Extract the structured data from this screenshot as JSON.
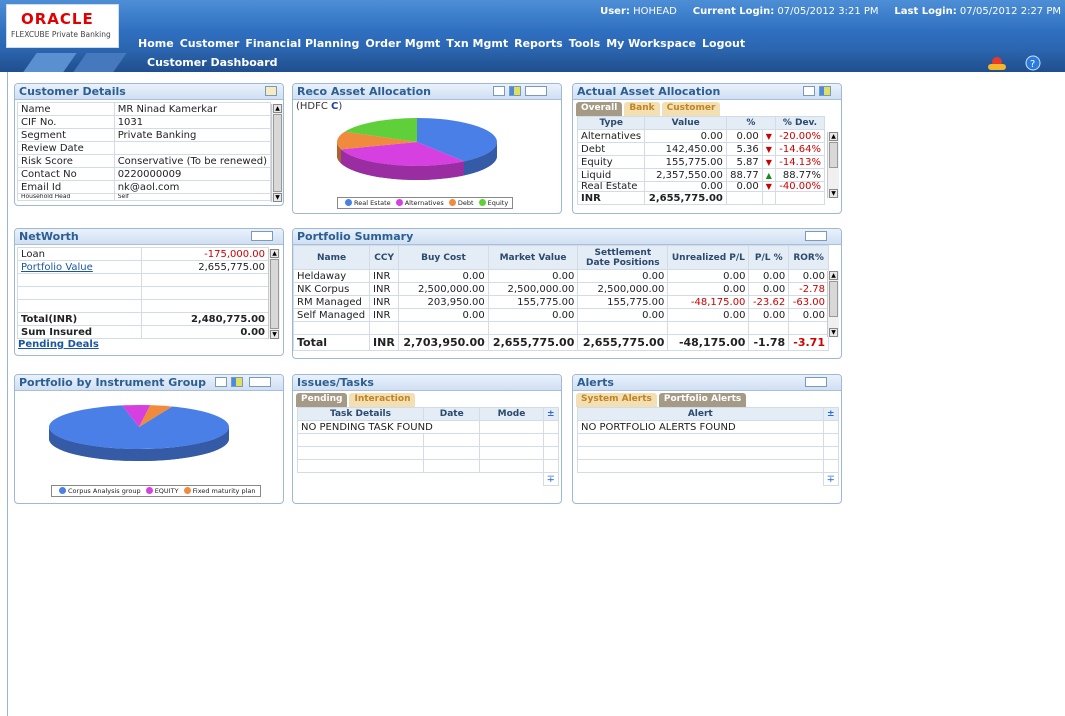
{
  "brand": {
    "logo": "ORACLE",
    "product": "FLEXCUBE Private Banking"
  },
  "session": {
    "user_label": "User:",
    "user": "HOHEAD",
    "current_label": "Current Login:",
    "current": "07/05/2012 3:21 PM",
    "last_label": "Last Login:",
    "last": "07/05/2012 2:27 PM"
  },
  "nav": [
    "Home",
    "Customer",
    "Financial Planning",
    "Order Mgmt",
    "Txn Mgmt",
    "Reports",
    "Tools",
    "My Workspace",
    "Logout"
  ],
  "page_title": "Customer Dashboard",
  "customer": {
    "title": "Customer Details",
    "rows": [
      [
        "Name",
        "MR Ninad Kamerkar"
      ],
      [
        "CIF No.",
        "1031"
      ],
      [
        "Segment",
        "Private Banking"
      ],
      [
        "Review Date",
        ""
      ],
      [
        "Risk Score",
        "Conservative (To be renewed)"
      ],
      [
        "Contact No",
        "0220000009"
      ],
      [
        "Email Id",
        "nk@aol.com"
      ],
      [
        "Household Head",
        "Self"
      ]
    ]
  },
  "reco": {
    "title": "Reco Asset Allocation",
    "sub_prefix": "(HDFC ",
    "sub_bold": "C",
    "sub_suffix": ")",
    "legend": [
      "Real Estate",
      "Alternatives",
      "Debt",
      "Equity"
    ],
    "values": [
      40,
      30,
      12,
      18
    ]
  },
  "actual": {
    "title": "Actual Asset Allocation",
    "tabs": [
      "Overall",
      "Bank",
      "Customer"
    ],
    "headers": [
      "Type",
      "Value",
      "%",
      "% Dev."
    ],
    "rows": [
      [
        "Alternatives",
        "0.00",
        "0.00",
        "down",
        "-20.00%"
      ],
      [
        "Debt",
        "142,450.00",
        "5.36",
        "down",
        "-14.64%"
      ],
      [
        "Equity",
        "155,775.00",
        "5.87",
        "down",
        "-14.13%"
      ],
      [
        "Liquid",
        "2,357,550.00",
        "88.77",
        "up",
        "88.77%"
      ],
      [
        "Real Estate",
        "0.00",
        "0.00",
        "down",
        "-40.00%"
      ]
    ],
    "total_label": "INR",
    "total": "2,655,775.00"
  },
  "networth": {
    "title": "NetWorth",
    "rows": [
      [
        "Loan",
        "-175,000.00"
      ],
      [
        "Portfolio Value",
        "2,655,775.00"
      ],
      [
        "",
        ""
      ],
      [
        "",
        ""
      ],
      [
        "",
        ""
      ]
    ],
    "total_label": "Total(INR)",
    "total": "2,480,775.00",
    "insured_label": "Sum Insured",
    "insured": "0.00",
    "pending": "Pending Deals"
  },
  "portfolio": {
    "title": "Portfolio Summary",
    "headers": [
      "Name",
      "CCY",
      "Buy Cost",
      "Market Value",
      "Settlement Date Positions",
      "Unrealized P/L",
      "P/L %",
      "ROR%"
    ],
    "rows": [
      [
        "Heldaway",
        "INR",
        "0.00",
        "0.00",
        "0.00",
        "0.00",
        "0.00",
        "0.00"
      ],
      [
        "NK Corpus",
        "INR",
        "2,500,000.00",
        "2,500,000.00",
        "2,500,000.00",
        "0.00",
        "0.00",
        "-2.78"
      ],
      [
        "RM Managed",
        "INR",
        "203,950.00",
        "155,775.00",
        "155,775.00",
        "-48,175.00",
        "-23.62",
        "-63.00"
      ],
      [
        "Self Managed",
        "INR",
        "0.00",
        "0.00",
        "0.00",
        "0.00",
        "0.00",
        "0.00"
      ]
    ],
    "total": [
      "Total",
      "INR",
      "2,703,950.00",
      "2,655,775.00",
      "2,655,775.00",
      "-48,175.00",
      "-1.78",
      "-3.71"
    ]
  },
  "instrument": {
    "title": "Portfolio by Instrument Group",
    "legend": [
      "Corpus Analysis group",
      "EQUITY",
      "Fixed maturity plan"
    ],
    "values": [
      91,
      5,
      4
    ]
  },
  "issues": {
    "title": "Issues/Tasks",
    "tabs": [
      "Pending",
      "Interaction"
    ],
    "headers": [
      "Task Details",
      "Date",
      "Mode"
    ],
    "empty": "NO PENDING TASK FOUND"
  },
  "alerts": {
    "title": "Alerts",
    "tabs": [
      "System Alerts",
      "Portfolio Alerts"
    ],
    "headers": [
      "Alert"
    ],
    "empty": "NO PORTFOLIO ALERTS FOUND"
  },
  "colors": {
    "real_estate": "#4a7fe8",
    "alternatives": "#d63fe0",
    "debt": "#f08a3c",
    "equity": "#5fcf3a"
  }
}
